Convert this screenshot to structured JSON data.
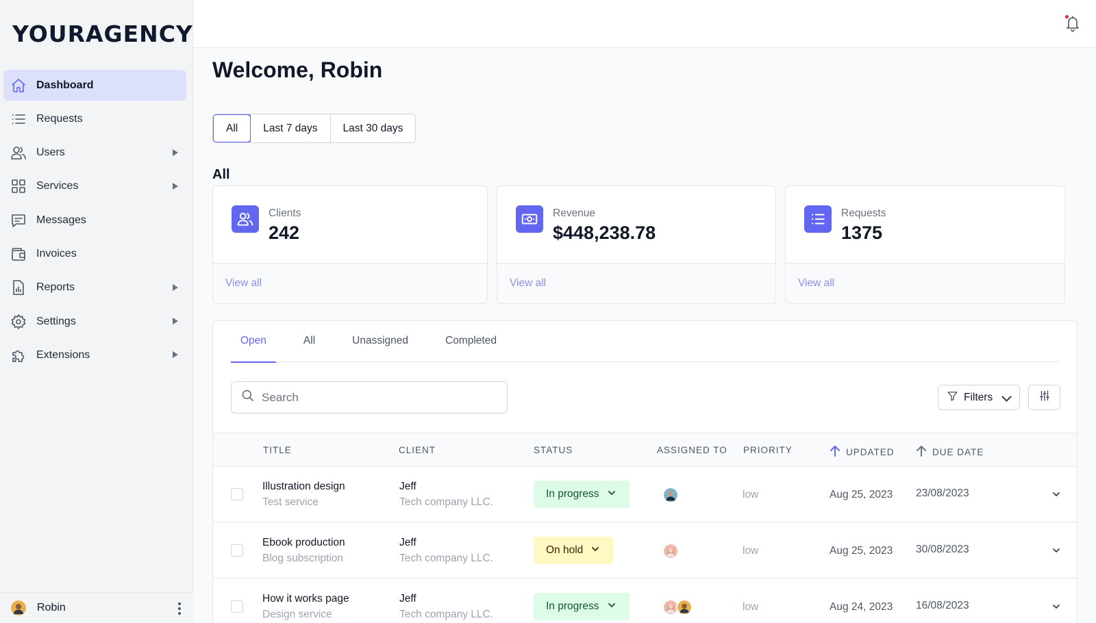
{
  "brand": {
    "logo_text": "YOURAGENCY"
  },
  "sidebar": {
    "items": [
      {
        "label": "Dashboard",
        "icon": "home-icon",
        "active": true,
        "has_submenu": false
      },
      {
        "label": "Requests",
        "icon": "list-icon",
        "active": false,
        "has_submenu": false
      },
      {
        "label": "Users",
        "icon": "users-icon",
        "active": false,
        "has_submenu": true
      },
      {
        "label": "Services",
        "icon": "grid-icon",
        "active": false,
        "has_submenu": true
      },
      {
        "label": "Messages",
        "icon": "message-icon",
        "active": false,
        "has_submenu": false
      },
      {
        "label": "Invoices",
        "icon": "wallet-icon",
        "active": false,
        "has_submenu": false
      },
      {
        "label": "Reports",
        "icon": "report-icon",
        "active": false,
        "has_submenu": true
      },
      {
        "label": "Settings",
        "icon": "gear-icon",
        "active": false,
        "has_submenu": true
      },
      {
        "label": "Extensions",
        "icon": "puzzle-icon",
        "active": false,
        "has_submenu": true
      }
    ],
    "user": {
      "name": "Robin"
    }
  },
  "header": {
    "notification_icon": "bell-icon",
    "has_unread": true
  },
  "main": {
    "welcome": "Welcome, Robin",
    "date_ranges": [
      "All",
      "Last 7 days",
      "Last 30 days"
    ],
    "active_range": "All",
    "section_title": "All",
    "stats": [
      {
        "label": "Clients",
        "value": "242",
        "icon": "users-icon",
        "link": "View all"
      },
      {
        "label": "Revenue",
        "value": "$448,238.78",
        "icon": "money-icon",
        "link": "View all"
      },
      {
        "label": "Requests",
        "value": "1375",
        "icon": "list-icon",
        "link": "View all"
      }
    ],
    "tabs": [
      "Open",
      "All",
      "Unassigned",
      "Completed"
    ],
    "active_tab": "Open",
    "search": {
      "placeholder": "Search"
    },
    "filters_label": "Filters",
    "columns": {
      "title": "Title",
      "client": "Client",
      "status": "Status",
      "assigned": "Assigned to",
      "priority": "Priority",
      "updated": "Updated",
      "due": "Due date"
    },
    "rows": [
      {
        "title": "Illustration design",
        "service": "Test service",
        "client": "Jeff",
        "company": "Tech company LLC.",
        "status": "In progress",
        "status_type": "progress",
        "assignees": [
          "man"
        ],
        "priority": "low",
        "updated": "Aug 25, 2023",
        "due": "23/08/2023"
      },
      {
        "title": "Ebook production",
        "service": "Blog subscription",
        "client": "Jeff",
        "company": "Tech company LLC.",
        "status": "On hold",
        "status_type": "hold",
        "assignees": [
          "woman"
        ],
        "priority": "low",
        "updated": "Aug 25, 2023",
        "due": "30/08/2023"
      },
      {
        "title": "How it works page",
        "service": "Design service",
        "client": "Jeff",
        "company": "Tech company LLC.",
        "status": "In progress",
        "status_type": "progress",
        "assignees": [
          "woman",
          "man"
        ],
        "priority": "low",
        "updated": "Aug 24, 2023",
        "due": "16/08/2023"
      }
    ]
  },
  "colors": {
    "accent": "#6366f1",
    "active_nav_bg": "#dde0fb",
    "progress_bg": "#dcfce7",
    "hold_bg": "#fef9c3",
    "link": "#8b90e8"
  }
}
